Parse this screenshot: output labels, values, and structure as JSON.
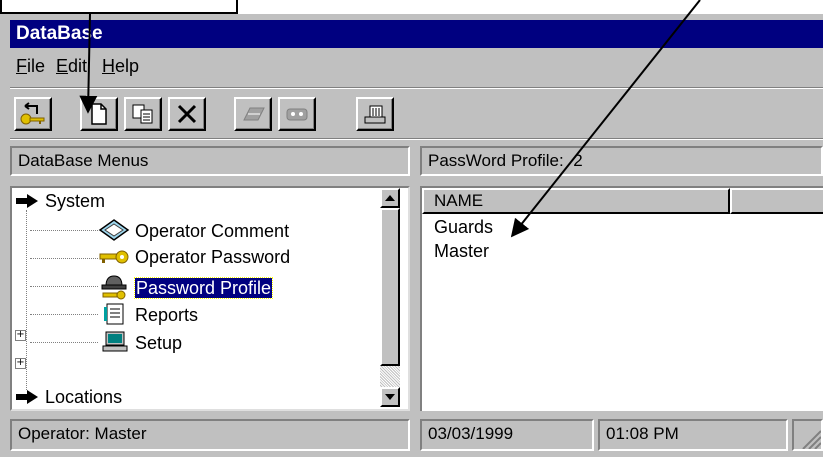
{
  "window": {
    "title": "DataBase"
  },
  "menu": {
    "items": [
      {
        "label": "File",
        "u": "F",
        "rest": "ile"
      },
      {
        "label": "Edit",
        "u": "E",
        "rest": "dit"
      },
      {
        "label": "Help",
        "u": "H",
        "rest": "elp"
      }
    ]
  },
  "toolbar": {
    "buttons": [
      {
        "icon": "key-return-icon"
      },
      {
        "icon": "new-document-icon"
      },
      {
        "icon": "copy-icon"
      },
      {
        "icon": "delete-x-icon"
      },
      {
        "icon": "eraser-icon"
      },
      {
        "icon": "tape-icon"
      },
      {
        "icon": "printer-icon"
      }
    ]
  },
  "left_panel": {
    "header": "DataBase Menus",
    "tree": [
      {
        "label": "System",
        "icon": "arrow-icon",
        "level": 0
      },
      {
        "label": "Operator Comment",
        "icon": "diamond-icon",
        "level": 1
      },
      {
        "label": "Operator Password",
        "icon": "key-icon",
        "level": 1
      },
      {
        "label": "Password Profile",
        "icon": "hat-key-icon",
        "level": 1,
        "selected": true
      },
      {
        "label": "Reports",
        "icon": "document-icon",
        "level": 1,
        "expandable": true
      },
      {
        "label": "Setup",
        "icon": "computer-icon",
        "level": 1,
        "expandable": true
      },
      {
        "label": "Locations",
        "icon": "arrow-icon",
        "level": 0
      }
    ]
  },
  "right_panel": {
    "header_label": "PassWord Profile:",
    "header_count": "2",
    "columns": [
      "NAME",
      ""
    ],
    "rows": [
      "Guards",
      "Master"
    ]
  },
  "status": {
    "operator": "Operator:  Master",
    "date": "03/03/1999",
    "time": "01:08 PM"
  },
  "colors": {
    "title_bg": "#000080",
    "face": "#c0c0c0",
    "selection": "#000080",
    "key": "#e0c000"
  }
}
